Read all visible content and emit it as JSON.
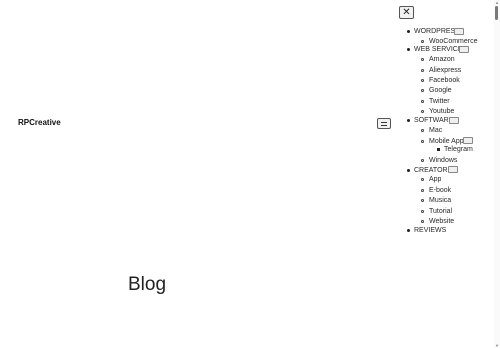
{
  "header": {
    "brand": "RPCreative",
    "close_glyph": "✕",
    "menu_toggle_icon": "hamburger-icon"
  },
  "menu": {
    "items": [
      {
        "label": "WORDPRESS",
        "has_toggle": true,
        "children": [
          {
            "label": "WooCommerce"
          }
        ]
      },
      {
        "label": "WEB SERVICES",
        "has_toggle": true,
        "children": [
          {
            "label": "Amazon"
          },
          {
            "label": "Aliexpress"
          },
          {
            "label": "Facebook"
          },
          {
            "label": "Google"
          },
          {
            "label": "Twitter"
          },
          {
            "label": "Youtube"
          }
        ]
      },
      {
        "label": "SOFTWARE",
        "has_toggle": true,
        "children": [
          {
            "label": "Mac"
          },
          {
            "label": "Mobile App",
            "has_toggle": true,
            "children": [
              {
                "label": "Telegram"
              }
            ]
          },
          {
            "label": "Windows"
          }
        ]
      },
      {
        "label": "CREATORS",
        "has_toggle": true,
        "children": [
          {
            "label": "App"
          },
          {
            "label": "E-book"
          },
          {
            "label": "Musica"
          },
          {
            "label": "Tutorial"
          },
          {
            "label": "Website"
          }
        ]
      },
      {
        "label": "REVIEWS",
        "has_toggle": false,
        "children": []
      }
    ]
  },
  "main": {
    "title": "Blog"
  }
}
